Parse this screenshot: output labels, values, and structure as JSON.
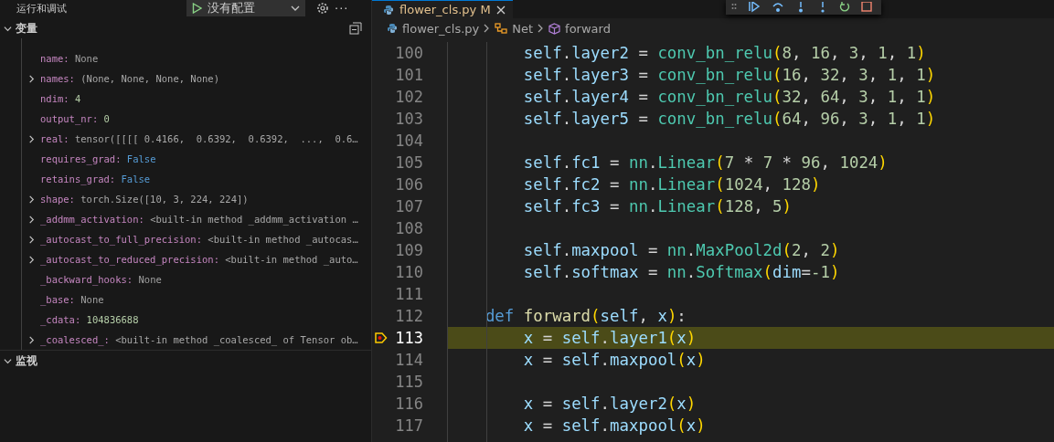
{
  "sidebar": {
    "title": "运行和调试",
    "config": {
      "label": "没有配置"
    },
    "more": "···",
    "sections": [
      {
        "title": "变量",
        "expanded": true,
        "variables": [
          {
            "key": "name:",
            "value": "None",
            "kind": "none",
            "expandable": false
          },
          {
            "key": "names:",
            "value": "(None, None, None, None)",
            "kind": "object",
            "expandable": true
          },
          {
            "key": "ndim:",
            "value": "4",
            "kind": "number",
            "expandable": false
          },
          {
            "key": "output_nr:",
            "value": "0",
            "kind": "number",
            "expandable": false
          },
          {
            "key": "real:",
            "value": "tensor([[[[ 0.4166,  0.6392,  0.6392,  ...,  0.6…",
            "kind": "object",
            "expandable": true
          },
          {
            "key": "requires_grad:",
            "value": "False",
            "kind": "bool",
            "expandable": false
          },
          {
            "key": "retains_grad:",
            "value": "False",
            "kind": "bool",
            "expandable": false
          },
          {
            "key": "shape:",
            "value": "torch.Size([10, 3, 224, 224])",
            "kind": "object",
            "expandable": true
          },
          {
            "key": "_addmm_activation:",
            "value": "<built-in method _addmm_activation …",
            "kind": "object",
            "expandable": true
          },
          {
            "key": "_autocast_to_full_precision:",
            "value": "<built-in method _autocas…",
            "kind": "object",
            "expandable": true
          },
          {
            "key": "_autocast_to_reduced_precision:",
            "value": "<built-in method _auto…",
            "kind": "object",
            "expandable": true
          },
          {
            "key": "_backward_hooks:",
            "value": "None",
            "kind": "none",
            "expandable": false
          },
          {
            "key": "_base:",
            "value": "None",
            "kind": "none",
            "expandable": false
          },
          {
            "key": "_cdata:",
            "value": "104836688",
            "kind": "number",
            "expandable": false
          },
          {
            "key": "_coalesced_:",
            "value": "<built-in method _coalesced_ of Tensor ob…",
            "kind": "object",
            "expandable": true
          }
        ]
      },
      {
        "title": "监视",
        "expanded": true
      }
    ]
  },
  "editor": {
    "tab": {
      "filename": "flower_cls.py",
      "status": "M",
      "selected": true
    },
    "breadcrumb": [
      {
        "label": "flower_cls.py",
        "kind": "file"
      },
      {
        "label": "Net",
        "kind": "class"
      },
      {
        "label": "forward",
        "kind": "method"
      }
    ],
    "lines": [
      {
        "number": "100",
        "current": false,
        "tokens": [
          {
            "text": "        self",
            "kind": "var"
          },
          {
            "text": ".",
            "kind": "op"
          },
          {
            "text": "layer2",
            "kind": "var"
          },
          {
            "text": " = ",
            "kind": "op"
          },
          {
            "text": "conv_bn_relu",
            "kind": "type"
          },
          {
            "text": "(",
            "kind": "paren"
          },
          {
            "text": "8",
            "kind": "num"
          },
          {
            "text": ", ",
            "kind": "op"
          },
          {
            "text": "16",
            "kind": "num"
          },
          {
            "text": ", ",
            "kind": "op"
          },
          {
            "text": "3",
            "kind": "num"
          },
          {
            "text": ", ",
            "kind": "op"
          },
          {
            "text": "1",
            "kind": "num"
          },
          {
            "text": ", ",
            "kind": "op"
          },
          {
            "text": "1",
            "kind": "num"
          },
          {
            "text": ")",
            "kind": "paren"
          }
        ]
      },
      {
        "number": "101",
        "current": false,
        "tokens": [
          {
            "text": "        self",
            "kind": "var"
          },
          {
            "text": ".",
            "kind": "op"
          },
          {
            "text": "layer3",
            "kind": "var"
          },
          {
            "text": " = ",
            "kind": "op"
          },
          {
            "text": "conv_bn_relu",
            "kind": "type"
          },
          {
            "text": "(",
            "kind": "paren"
          },
          {
            "text": "16",
            "kind": "num"
          },
          {
            "text": ", ",
            "kind": "op"
          },
          {
            "text": "32",
            "kind": "num"
          },
          {
            "text": ", ",
            "kind": "op"
          },
          {
            "text": "3",
            "kind": "num"
          },
          {
            "text": ", ",
            "kind": "op"
          },
          {
            "text": "1",
            "kind": "num"
          },
          {
            "text": ", ",
            "kind": "op"
          },
          {
            "text": "1",
            "kind": "num"
          },
          {
            "text": ")",
            "kind": "paren"
          }
        ]
      },
      {
        "number": "102",
        "current": false,
        "tokens": [
          {
            "text": "        self",
            "kind": "var"
          },
          {
            "text": ".",
            "kind": "op"
          },
          {
            "text": "layer4",
            "kind": "var"
          },
          {
            "text": " = ",
            "kind": "op"
          },
          {
            "text": "conv_bn_relu",
            "kind": "type"
          },
          {
            "text": "(",
            "kind": "paren"
          },
          {
            "text": "32",
            "kind": "num"
          },
          {
            "text": ", ",
            "kind": "op"
          },
          {
            "text": "64",
            "kind": "num"
          },
          {
            "text": ", ",
            "kind": "op"
          },
          {
            "text": "3",
            "kind": "num"
          },
          {
            "text": ", ",
            "kind": "op"
          },
          {
            "text": "1",
            "kind": "num"
          },
          {
            "text": ", ",
            "kind": "op"
          },
          {
            "text": "1",
            "kind": "num"
          },
          {
            "text": ")",
            "kind": "paren"
          }
        ]
      },
      {
        "number": "103",
        "current": false,
        "tokens": [
          {
            "text": "        self",
            "kind": "var"
          },
          {
            "text": ".",
            "kind": "op"
          },
          {
            "text": "layer5",
            "kind": "var"
          },
          {
            "text": " = ",
            "kind": "op"
          },
          {
            "text": "conv_bn_relu",
            "kind": "type"
          },
          {
            "text": "(",
            "kind": "paren"
          },
          {
            "text": "64",
            "kind": "num"
          },
          {
            "text": ", ",
            "kind": "op"
          },
          {
            "text": "96",
            "kind": "num"
          },
          {
            "text": ", ",
            "kind": "op"
          },
          {
            "text": "3",
            "kind": "num"
          },
          {
            "text": ", ",
            "kind": "op"
          },
          {
            "text": "1",
            "kind": "num"
          },
          {
            "text": ", ",
            "kind": "op"
          },
          {
            "text": "1",
            "kind": "num"
          },
          {
            "text": ")",
            "kind": "paren"
          }
        ]
      },
      {
        "number": "104",
        "current": false
      },
      {
        "number": "105",
        "current": false,
        "tokens": [
          {
            "text": "        self",
            "kind": "var"
          },
          {
            "text": ".",
            "kind": "op"
          },
          {
            "text": "fc1",
            "kind": "var"
          },
          {
            "text": " = ",
            "kind": "op"
          },
          {
            "text": "nn",
            "kind": "type"
          },
          {
            "text": ".",
            "kind": "op"
          },
          {
            "text": "Linear",
            "kind": "type"
          },
          {
            "text": "(",
            "kind": "paren"
          },
          {
            "text": "7",
            "kind": "num"
          },
          {
            "text": " * ",
            "kind": "op"
          },
          {
            "text": "7",
            "kind": "num"
          },
          {
            "text": " * ",
            "kind": "op"
          },
          {
            "text": "96",
            "kind": "num"
          },
          {
            "text": ", ",
            "kind": "op"
          },
          {
            "text": "1024",
            "kind": "num"
          },
          {
            "text": ")",
            "kind": "paren"
          }
        ]
      },
      {
        "number": "106",
        "current": false,
        "tokens": [
          {
            "text": "        self",
            "kind": "var"
          },
          {
            "text": ".",
            "kind": "op"
          },
          {
            "text": "fc2",
            "kind": "var"
          },
          {
            "text": " = ",
            "kind": "op"
          },
          {
            "text": "nn",
            "kind": "type"
          },
          {
            "text": ".",
            "kind": "op"
          },
          {
            "text": "Linear",
            "kind": "type"
          },
          {
            "text": "(",
            "kind": "paren"
          },
          {
            "text": "1024",
            "kind": "num"
          },
          {
            "text": ", ",
            "kind": "op"
          },
          {
            "text": "128",
            "kind": "num"
          },
          {
            "text": ")",
            "kind": "paren"
          }
        ]
      },
      {
        "number": "107",
        "current": false,
        "tokens": [
          {
            "text": "        self",
            "kind": "var"
          },
          {
            "text": ".",
            "kind": "op"
          },
          {
            "text": "fc3",
            "kind": "var"
          },
          {
            "text": " = ",
            "kind": "op"
          },
          {
            "text": "nn",
            "kind": "type"
          },
          {
            "text": ".",
            "kind": "op"
          },
          {
            "text": "Linear",
            "kind": "type"
          },
          {
            "text": "(",
            "kind": "paren"
          },
          {
            "text": "128",
            "kind": "num"
          },
          {
            "text": ", ",
            "kind": "op"
          },
          {
            "text": "5",
            "kind": "num"
          },
          {
            "text": ")",
            "kind": "paren"
          }
        ]
      },
      {
        "number": "108",
        "current": false
      },
      {
        "number": "109",
        "current": false,
        "tokens": [
          {
            "text": "        self",
            "kind": "var"
          },
          {
            "text": ".",
            "kind": "op"
          },
          {
            "text": "maxpool",
            "kind": "var"
          },
          {
            "text": " = ",
            "kind": "op"
          },
          {
            "text": "nn",
            "kind": "type"
          },
          {
            "text": ".",
            "kind": "op"
          },
          {
            "text": "MaxPool2d",
            "kind": "type"
          },
          {
            "text": "(",
            "kind": "paren"
          },
          {
            "text": "2",
            "kind": "num"
          },
          {
            "text": ", ",
            "kind": "op"
          },
          {
            "text": "2",
            "kind": "num"
          },
          {
            "text": ")",
            "kind": "paren"
          }
        ]
      },
      {
        "number": "110",
        "current": false,
        "tokens": [
          {
            "text": "        self",
            "kind": "var"
          },
          {
            "text": ".",
            "kind": "op"
          },
          {
            "text": "softmax",
            "kind": "var"
          },
          {
            "text": " = ",
            "kind": "op"
          },
          {
            "text": "nn",
            "kind": "type"
          },
          {
            "text": ".",
            "kind": "op"
          },
          {
            "text": "Softmax",
            "kind": "type"
          },
          {
            "text": "(",
            "kind": "paren"
          },
          {
            "text": "dim",
            "kind": "var"
          },
          {
            "text": "=",
            "kind": "op"
          },
          {
            "text": "-1",
            "kind": "num"
          },
          {
            "text": ")",
            "kind": "paren"
          }
        ]
      },
      {
        "number": "111",
        "current": false
      },
      {
        "number": "112",
        "current": false,
        "tokens": [
          {
            "text": "    def ",
            "kind": "keyword"
          },
          {
            "text": "forward",
            "kind": "func"
          },
          {
            "text": "(",
            "kind": "paren"
          },
          {
            "text": "self",
            "kind": "var"
          },
          {
            "text": ", ",
            "kind": "op"
          },
          {
            "text": "x",
            "kind": "var"
          },
          {
            "text": ")",
            "kind": "paren"
          },
          {
            "text": ":",
            "kind": "op"
          }
        ]
      },
      {
        "number": "113",
        "current": true,
        "tokens": [
          {
            "text": "        x",
            "kind": "var"
          },
          {
            "text": " = ",
            "kind": "op"
          },
          {
            "text": "self",
            "kind": "var"
          },
          {
            "text": ".",
            "kind": "op"
          },
          {
            "text": "layer1",
            "kind": "var"
          },
          {
            "text": "(",
            "kind": "paren"
          },
          {
            "text": "x",
            "kind": "var"
          },
          {
            "text": ")",
            "kind": "paren"
          }
        ]
      },
      {
        "number": "114",
        "current": false,
        "tokens": [
          {
            "text": "        x",
            "kind": "var"
          },
          {
            "text": " = ",
            "kind": "op"
          },
          {
            "text": "self",
            "kind": "var"
          },
          {
            "text": ".",
            "kind": "op"
          },
          {
            "text": "maxpool",
            "kind": "var"
          },
          {
            "text": "(",
            "kind": "paren"
          },
          {
            "text": "x",
            "kind": "var"
          },
          {
            "text": ")",
            "kind": "paren"
          }
        ]
      },
      {
        "number": "115",
        "current": false
      },
      {
        "number": "116",
        "current": false,
        "tokens": [
          {
            "text": "        x",
            "kind": "var"
          },
          {
            "text": " = ",
            "kind": "op"
          },
          {
            "text": "self",
            "kind": "var"
          },
          {
            "text": ".",
            "kind": "op"
          },
          {
            "text": "layer2",
            "kind": "var"
          },
          {
            "text": "(",
            "kind": "paren"
          },
          {
            "text": "x",
            "kind": "var"
          },
          {
            "text": ")",
            "kind": "paren"
          }
        ]
      },
      {
        "number": "117",
        "current": false,
        "tokens": [
          {
            "text": "        x",
            "kind": "var"
          },
          {
            "text": " = ",
            "kind": "op"
          },
          {
            "text": "self",
            "kind": "var"
          },
          {
            "text": ".",
            "kind": "op"
          },
          {
            "text": "maxpool",
            "kind": "var"
          },
          {
            "text": "(",
            "kind": "paren"
          },
          {
            "text": "x",
            "kind": "var"
          },
          {
            "text": ")",
            "kind": "paren"
          }
        ]
      }
    ]
  }
}
